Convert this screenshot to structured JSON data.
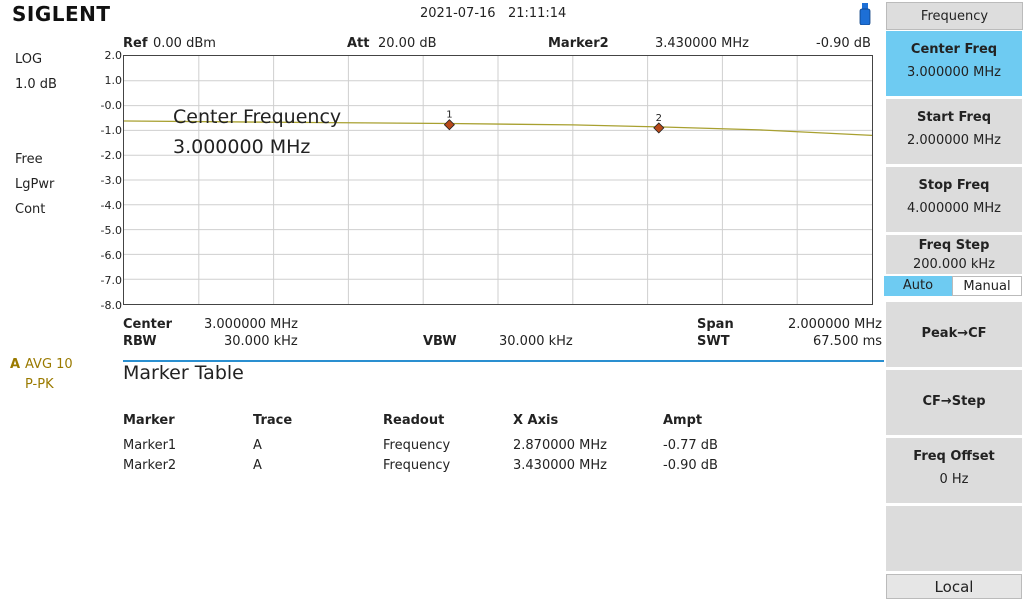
{
  "brand": "SIGLENT",
  "datetime": "2021-07-16   21:11:14",
  "left_status": {
    "scale_type": "LOG",
    "scale_div": "1.0 dB",
    "trigger": "Free",
    "detector": "LgPwr",
    "sweep_mode": "Cont",
    "trace_letter": "A",
    "trace_mode": "AVG 10",
    "trace_detector": "P-PK"
  },
  "header": {
    "ref_label": "Ref",
    "ref_value": "0.00 dBm",
    "att_label": "Att",
    "att_value": "20.00 dB",
    "marker_label": "Marker2",
    "marker_freq": "3.430000 MHz",
    "marker_ampl": "-0.90 dB"
  },
  "y_ticks": [
    "2.0",
    "1.0",
    "-0.0",
    "-1.0",
    "-2.0",
    "-3.0",
    "-4.0",
    "-5.0",
    "-6.0",
    "-7.0",
    "-8.0"
  ],
  "overlay": {
    "line1": "Center Frequency",
    "line2": "3.000000 MHz"
  },
  "footer": {
    "center_label": "Center",
    "center_value": "3.000000 MHz",
    "rbw_label": "RBW",
    "rbw_value": "30.000 kHz",
    "vbw_label": "VBW",
    "vbw_value": "30.000 kHz",
    "span_label": "Span",
    "span_value": "2.000000 MHz",
    "swt_label": "SWT",
    "swt_value": "67.500 ms"
  },
  "marker_table": {
    "title": "Marker Table",
    "columns": [
      "Marker",
      "Trace",
      "Readout",
      "X Axis",
      "Ampt"
    ],
    "rows": [
      [
        "Marker1",
        "A",
        "Frequency",
        "2.870000 MHz",
        "-0.77 dB"
      ],
      [
        "Marker2",
        "A",
        "Frequency",
        "3.430000 MHz",
        "-0.90 dB"
      ]
    ]
  },
  "softkeys": {
    "menu_title": "Frequency",
    "center_freq_label": "Center Freq",
    "center_freq_value": "3.000000 MHz",
    "start_freq_label": "Start Freq",
    "start_freq_value": "2.000000 MHz",
    "stop_freq_label": "Stop Freq",
    "stop_freq_value": "4.000000 MHz",
    "freq_step_label": "Freq Step",
    "freq_step_value": "200.000 kHz",
    "auto_label": "Auto",
    "manual_label": "Manual",
    "peak_cf_label": "Peak→CF",
    "cf_step_label": "CF→Step",
    "freq_offset_label": "Freq Offset",
    "freq_offset_value": "0 Hz",
    "local_label": "Local"
  },
  "trace": {
    "color": "#a8a030",
    "x_start_mhz": 2.0,
    "x_stop_mhz": 4.0,
    "y_top_db": 2.0,
    "y_bottom_db": -8.0,
    "points_mhz_db": [
      [
        2.0,
        -0.62
      ],
      [
        2.5,
        -0.68
      ],
      [
        2.87,
        -0.72
      ],
      [
        3.2,
        -0.78
      ],
      [
        3.43,
        -0.86
      ],
      [
        3.7,
        -0.98
      ],
      [
        4.0,
        -1.2
      ]
    ],
    "markers": [
      {
        "label": "1",
        "freq_mhz": 2.87,
        "ampl_db": -0.77
      },
      {
        "label": "2",
        "freq_mhz": 3.43,
        "ampl_db": -0.9
      }
    ]
  },
  "colors": {
    "accent": "#6ecbf2",
    "divider": "#2a8fd0",
    "marker_fill": "#b84a1a",
    "trace_label": "#9a7a00"
  }
}
